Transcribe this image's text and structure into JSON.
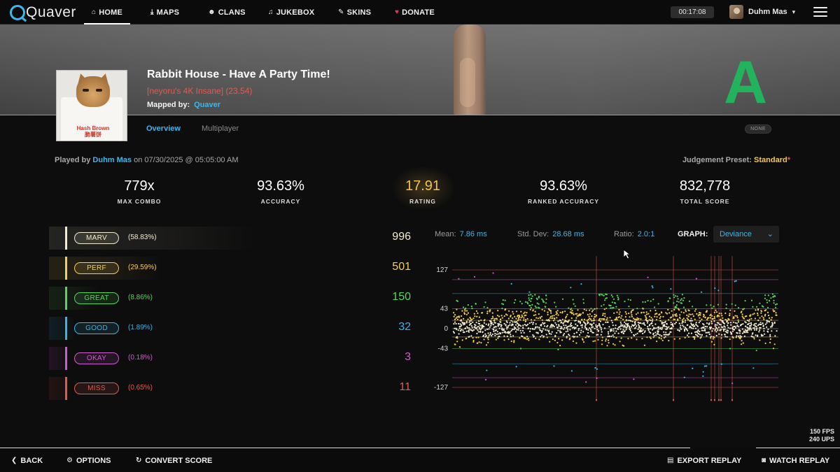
{
  "app": {
    "logo_text": "Quaver"
  },
  "nav": {
    "items": [
      {
        "label": "HOME",
        "icon": "home-icon",
        "glyph": "⌂"
      },
      {
        "label": "MAPS",
        "icon": "download-icon",
        "glyph": "⤓"
      },
      {
        "label": "CLANS",
        "icon": "users-icon",
        "glyph": "☻"
      },
      {
        "label": "JUKEBOX",
        "icon": "music-icon",
        "glyph": "♫"
      },
      {
        "label": "SKINS",
        "icon": "brush-icon",
        "glyph": "✎"
      },
      {
        "label": "DONATE",
        "icon": "heart-icon",
        "glyph": "♥"
      }
    ],
    "timer": "00:17:08",
    "username": "Duhm Mas"
  },
  "map": {
    "title": "Rabbit House - Have A Party Time!",
    "difficulty": "[neyoru's 4K Insane] (23.54)",
    "mapped_by_label": "Mapped by:",
    "mapper": "Quaver",
    "grade": "A",
    "cover_text": "Hash Brown\n脆薯饼"
  },
  "tabs": {
    "overview": "Overview",
    "multiplayer": "Multiplayer",
    "mods": "NONE"
  },
  "meta": {
    "played_by_label": "Played by",
    "player": "Duhm Mas",
    "date_text": "on 07/30/2025 @ 05:05:00 AM",
    "preset_label": "Judgement Preset:",
    "preset_value": "Standard",
    "preset_mark": "*"
  },
  "stats": [
    {
      "value": "779x",
      "label": "MAX COMBO"
    },
    {
      "value": "93.63%",
      "label": "ACCURACY"
    },
    {
      "value": "17.91",
      "label": "RATING"
    },
    {
      "value": "93.63%",
      "label": "RANKED ACCURACY"
    },
    {
      "value": "832,778",
      "label": "TOTAL SCORE"
    }
  ],
  "judgements": [
    {
      "name": "MARV",
      "pct": "(58.83%)",
      "count": "996",
      "color": "#f2ecd0",
      "fill": 0.5883
    },
    {
      "name": "PERF",
      "pct": "(29.59%)",
      "count": "501",
      "color": "#f5cf55",
      "fill": 0.2959
    },
    {
      "name": "GREAT",
      "pct": "(8.86%)",
      "count": "150",
      "color": "#5cd35f",
      "fill": 0.0886
    },
    {
      "name": "GOOD",
      "pct": "(1.89%)",
      "count": "32",
      "color": "#38b5e8",
      "fill": 0.0189
    },
    {
      "name": "OKAY",
      "pct": "(0.18%)",
      "count": "3",
      "color": "#cf5ccc",
      "fill": 0.0018
    },
    {
      "name": "MISS",
      "pct": "(0.65%)",
      "count": "11",
      "color": "#e25a4f",
      "fill": 0.0065
    }
  ],
  "graph": {
    "mean_label": "Mean:",
    "mean": "7.86 ms",
    "stddev_label": "Std. Dev:",
    "stddev": "28.68 ms",
    "ratio_label": "Ratio:",
    "ratio": "2.0:1",
    "graph_label": "GRAPH:",
    "graph_mode": "Deviance",
    "axis_labels": [
      "127",
      "43",
      "0",
      "-43",
      "-127"
    ]
  },
  "perf": {
    "fps": "150 FPS",
    "ups": "240 UPS"
  },
  "bottom": {
    "back": "BACK",
    "options": "OPTIONS",
    "convert": "CONVERT SCORE",
    "export": "EXPORT REPLAY",
    "watch": "WATCH REPLAY"
  }
}
